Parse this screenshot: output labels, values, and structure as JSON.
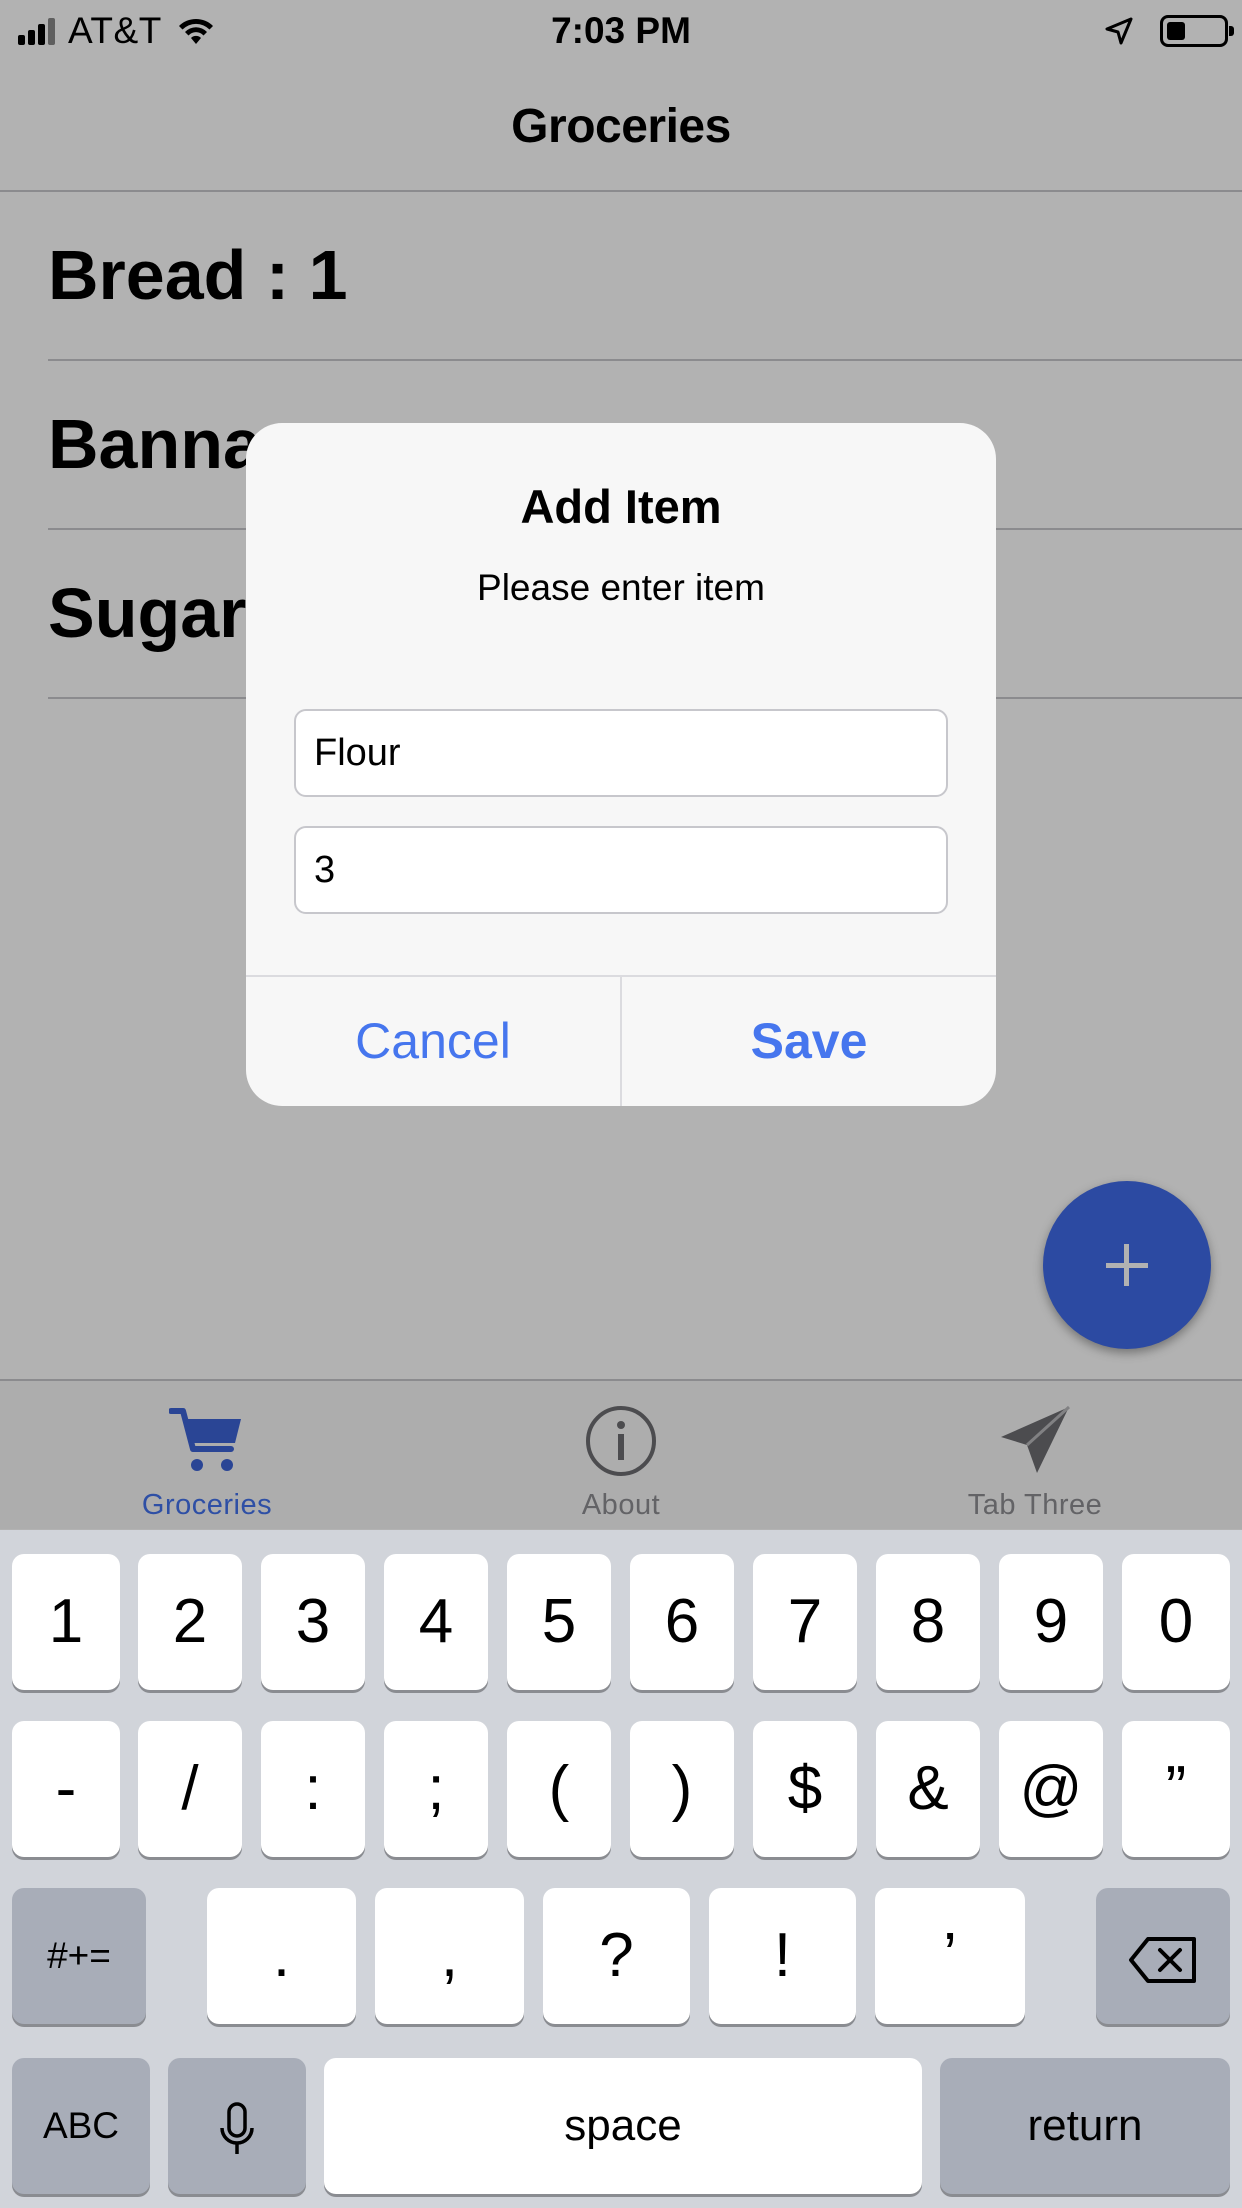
{
  "status_bar": {
    "carrier": "AT&T",
    "time": "7:03 PM",
    "icons": [
      "signal-icon",
      "wifi-icon",
      "location-icon",
      "battery-icon"
    ]
  },
  "nav": {
    "title": "Groceries"
  },
  "list": {
    "items": [
      "Bread : 1",
      "Banna",
      "Sugar"
    ]
  },
  "alert": {
    "title": "Add Item",
    "message": "Please enter item",
    "item_value": "Flour",
    "quantity_value": "3",
    "cancel_label": "Cancel",
    "save_label": "Save"
  },
  "fab": {
    "icon": "plus-icon"
  },
  "tabs": [
    {
      "label": "Groceries",
      "icon": "cart-icon",
      "active": true
    },
    {
      "label": "About",
      "icon": "info-icon",
      "active": false
    },
    {
      "label": "Tab Three",
      "icon": "send-icon",
      "active": false
    }
  ],
  "keyboard": {
    "row1": [
      "1",
      "2",
      "3",
      "4",
      "5",
      "6",
      "7",
      "8",
      "9",
      "0"
    ],
    "row2": [
      "-",
      "/",
      ":",
      ";",
      "(",
      ")",
      "$",
      "&",
      "@",
      "”"
    ],
    "row3": {
      "toggle": "#+=",
      "keys": [
        ".",
        ",",
        "?",
        "!",
        "’"
      ],
      "delete_icon": "backspace-icon"
    },
    "row4": {
      "abc": "ABC",
      "mic_icon": "microphone-icon",
      "space": "space",
      "return": "return"
    }
  },
  "colors": {
    "accent": "#4272ec",
    "fab": "#3f6ae8",
    "alert_button": "#4676ee",
    "keyboard_bg": "#d1d4da"
  }
}
